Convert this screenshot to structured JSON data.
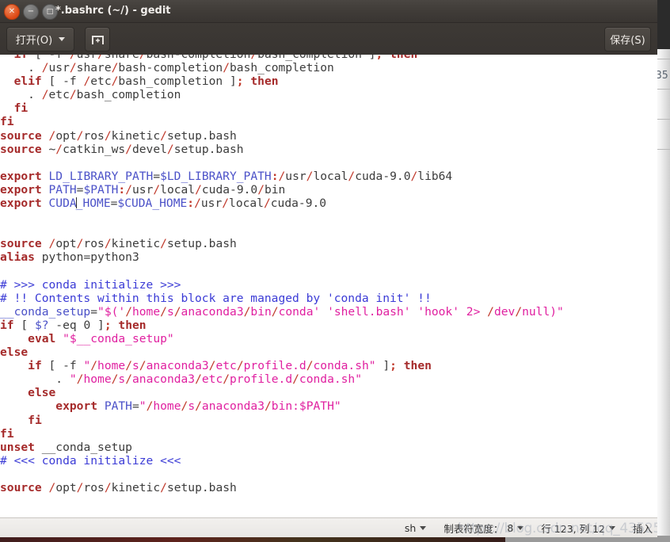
{
  "window": {
    "title": "*.bashrc (~/) - gedit",
    "controls": [
      {
        "name": "close",
        "glyph": "✕"
      },
      {
        "name": "minimize",
        "glyph": "−"
      },
      {
        "name": "maximize",
        "glyph": "□"
      }
    ]
  },
  "toolbar": {
    "open_label": "打开(O)",
    "new_tab_tooltip": "new-document",
    "save_label": "保存(S)"
  },
  "statusbar": {
    "language": "sh",
    "tab_width_label": "制表符宽度：",
    "tab_width_value": "8",
    "position": "行 123, 列 12",
    "insert_mode": "插入"
  },
  "watermark": "https://blog.csdn.net/qq_43525",
  "background_window": {
    "visible_number": "35"
  },
  "editor": {
    "lines": [
      [
        {
          "t": "tx",
          "s": "  "
        },
        {
          "t": "kw",
          "s": "if"
        },
        {
          "t": "tx",
          "s": " [ -f "
        },
        {
          "t": "pl",
          "s": "/"
        },
        {
          "t": "tx",
          "s": "usr"
        },
        {
          "t": "pl",
          "s": "/"
        },
        {
          "t": "tx",
          "s": "share"
        },
        {
          "t": "pl",
          "s": "/"
        },
        {
          "t": "tx",
          "s": "bash-completion"
        },
        {
          "t": "pl",
          "s": "/"
        },
        {
          "t": "tx",
          "s": "bash_completion ]"
        },
        {
          "t": "op",
          "s": ";"
        },
        {
          "t": "tx",
          "s": " "
        },
        {
          "t": "kw",
          "s": "then"
        }
      ],
      [
        {
          "t": "tx",
          "s": "    . "
        },
        {
          "t": "pl",
          "s": "/"
        },
        {
          "t": "tx",
          "s": "usr"
        },
        {
          "t": "pl",
          "s": "/"
        },
        {
          "t": "tx",
          "s": "share"
        },
        {
          "t": "pl",
          "s": "/"
        },
        {
          "t": "tx",
          "s": "bash-completion"
        },
        {
          "t": "pl",
          "s": "/"
        },
        {
          "t": "tx",
          "s": "bash_completion"
        }
      ],
      [
        {
          "t": "tx",
          "s": "  "
        },
        {
          "t": "kw",
          "s": "elif"
        },
        {
          "t": "tx",
          "s": " [ -f "
        },
        {
          "t": "pl",
          "s": "/"
        },
        {
          "t": "tx",
          "s": "etc"
        },
        {
          "t": "pl",
          "s": "/"
        },
        {
          "t": "tx",
          "s": "bash_completion ]"
        },
        {
          "t": "op",
          "s": ";"
        },
        {
          "t": "tx",
          "s": " "
        },
        {
          "t": "kw",
          "s": "then"
        }
      ],
      [
        {
          "t": "tx",
          "s": "    . "
        },
        {
          "t": "pl",
          "s": "/"
        },
        {
          "t": "tx",
          "s": "etc"
        },
        {
          "t": "pl",
          "s": "/"
        },
        {
          "t": "tx",
          "s": "bash_completion"
        }
      ],
      [
        {
          "t": "tx",
          "s": "  "
        },
        {
          "t": "kw",
          "s": "fi"
        }
      ],
      [
        {
          "t": "kw",
          "s": "fi"
        }
      ],
      [
        {
          "t": "kw",
          "s": "source"
        },
        {
          "t": "tx",
          "s": " "
        },
        {
          "t": "pl",
          "s": "/"
        },
        {
          "t": "tx",
          "s": "opt"
        },
        {
          "t": "pl",
          "s": "/"
        },
        {
          "t": "tx",
          "s": "ros"
        },
        {
          "t": "pl",
          "s": "/"
        },
        {
          "t": "tx",
          "s": "kinetic"
        },
        {
          "t": "pl",
          "s": "/"
        },
        {
          "t": "tx",
          "s": "setup.bash"
        }
      ],
      [
        {
          "t": "kw",
          "s": "source"
        },
        {
          "t": "tx",
          "s": " ~"
        },
        {
          "t": "pl",
          "s": "/"
        },
        {
          "t": "tx",
          "s": "catkin_ws"
        },
        {
          "t": "pl",
          "s": "/"
        },
        {
          "t": "tx",
          "s": "devel"
        },
        {
          "t": "pl",
          "s": "/"
        },
        {
          "t": "tx",
          "s": "setup.bash"
        }
      ],
      [],
      [
        {
          "t": "kw",
          "s": "export"
        },
        {
          "t": "tx",
          "s": " "
        },
        {
          "t": "var",
          "s": "LD_LIBRARY_PATH"
        },
        {
          "t": "tx",
          "s": "="
        },
        {
          "t": "var",
          "s": "$LD_LIBRARY_PATH"
        },
        {
          "t": "op",
          "s": ":"
        },
        {
          "t": "pl",
          "s": "/"
        },
        {
          "t": "tx",
          "s": "usr"
        },
        {
          "t": "pl",
          "s": "/"
        },
        {
          "t": "tx",
          "s": "local"
        },
        {
          "t": "pl",
          "s": "/"
        },
        {
          "t": "tx",
          "s": "cuda-9.0"
        },
        {
          "t": "pl",
          "s": "/"
        },
        {
          "t": "tx",
          "s": "lib64"
        }
      ],
      [
        {
          "t": "kw",
          "s": "export"
        },
        {
          "t": "tx",
          "s": " "
        },
        {
          "t": "var",
          "s": "PATH"
        },
        {
          "t": "tx",
          "s": "="
        },
        {
          "t": "var",
          "s": "$PATH"
        },
        {
          "t": "op",
          "s": ":"
        },
        {
          "t": "pl",
          "s": "/"
        },
        {
          "t": "tx",
          "s": "usr"
        },
        {
          "t": "pl",
          "s": "/"
        },
        {
          "t": "tx",
          "s": "local"
        },
        {
          "t": "pl",
          "s": "/"
        },
        {
          "t": "tx",
          "s": "cuda-9.0"
        },
        {
          "t": "pl",
          "s": "/"
        },
        {
          "t": "tx",
          "s": "bin"
        }
      ],
      [
        {
          "t": "kw",
          "s": "export"
        },
        {
          "t": "tx",
          "s": " "
        },
        {
          "t": "var",
          "s": "CUDA"
        },
        {
          "t": "caret",
          "s": ""
        },
        {
          "t": "var",
          "s": "_HOME"
        },
        {
          "t": "tx",
          "s": "="
        },
        {
          "t": "var",
          "s": "$CUDA_HOME"
        },
        {
          "t": "op",
          "s": ":"
        },
        {
          "t": "pl",
          "s": "/"
        },
        {
          "t": "tx",
          "s": "usr"
        },
        {
          "t": "pl",
          "s": "/"
        },
        {
          "t": "tx",
          "s": "local"
        },
        {
          "t": "pl",
          "s": "/"
        },
        {
          "t": "tx",
          "s": "cuda-9.0"
        }
      ],
      [],
      [],
      [
        {
          "t": "kw",
          "s": "source"
        },
        {
          "t": "tx",
          "s": " "
        },
        {
          "t": "pl",
          "s": "/"
        },
        {
          "t": "tx",
          "s": "opt"
        },
        {
          "t": "pl",
          "s": "/"
        },
        {
          "t": "tx",
          "s": "ros"
        },
        {
          "t": "pl",
          "s": "/"
        },
        {
          "t": "tx",
          "s": "kinetic"
        },
        {
          "t": "pl",
          "s": "/"
        },
        {
          "t": "tx",
          "s": "setup.bash"
        }
      ],
      [
        {
          "t": "kw",
          "s": "alias"
        },
        {
          "t": "tx",
          "s": " python=python3"
        }
      ],
      [],
      [
        {
          "t": "cm",
          "s": "# >>> conda initialize >>>"
        }
      ],
      [
        {
          "t": "cm",
          "s": "# !! Contents within this block are managed by 'conda init' !!"
        }
      ],
      [
        {
          "t": "var",
          "s": "__conda_setup"
        },
        {
          "t": "tx",
          "s": "="
        },
        {
          "t": "st",
          "s": "\"$('"
        },
        {
          "t": "pl",
          "s": "/"
        },
        {
          "t": "st",
          "s": "home"
        },
        {
          "t": "pl",
          "s": "/"
        },
        {
          "t": "st",
          "s": "s"
        },
        {
          "t": "pl",
          "s": "/"
        },
        {
          "t": "st",
          "s": "anaconda3"
        },
        {
          "t": "pl",
          "s": "/"
        },
        {
          "t": "st",
          "s": "bin"
        },
        {
          "t": "pl",
          "s": "/"
        },
        {
          "t": "st",
          "s": "conda' 'shell.bash' 'hook' 2> "
        },
        {
          "t": "pl",
          "s": "/"
        },
        {
          "t": "st",
          "s": "dev"
        },
        {
          "t": "pl",
          "s": "/"
        },
        {
          "t": "st",
          "s": "null)\""
        }
      ],
      [
        {
          "t": "kw",
          "s": "if"
        },
        {
          "t": "tx",
          "s": " [ "
        },
        {
          "t": "var",
          "s": "$?"
        },
        {
          "t": "tx",
          "s": " -eq 0 ]"
        },
        {
          "t": "op",
          "s": ";"
        },
        {
          "t": "tx",
          "s": " "
        },
        {
          "t": "kw",
          "s": "then"
        }
      ],
      [
        {
          "t": "tx",
          "s": "    "
        },
        {
          "t": "kw",
          "s": "eval"
        },
        {
          "t": "tx",
          "s": " "
        },
        {
          "t": "st",
          "s": "\"$__conda_setup\""
        }
      ],
      [
        {
          "t": "kw",
          "s": "else"
        }
      ],
      [
        {
          "t": "tx",
          "s": "    "
        },
        {
          "t": "kw",
          "s": "if"
        },
        {
          "t": "tx",
          "s": " [ -f "
        },
        {
          "t": "st",
          "s": "\""
        },
        {
          "t": "pl",
          "s": "/"
        },
        {
          "t": "st",
          "s": "home"
        },
        {
          "t": "pl",
          "s": "/"
        },
        {
          "t": "st",
          "s": "s"
        },
        {
          "t": "pl",
          "s": "/"
        },
        {
          "t": "st",
          "s": "anaconda3"
        },
        {
          "t": "pl",
          "s": "/"
        },
        {
          "t": "st",
          "s": "etc"
        },
        {
          "t": "pl",
          "s": "/"
        },
        {
          "t": "st",
          "s": "profile.d"
        },
        {
          "t": "pl",
          "s": "/"
        },
        {
          "t": "st",
          "s": "conda.sh\""
        },
        {
          "t": "tx",
          "s": " ]"
        },
        {
          "t": "op",
          "s": ";"
        },
        {
          "t": "tx",
          "s": " "
        },
        {
          "t": "kw",
          "s": "then"
        }
      ],
      [
        {
          "t": "tx",
          "s": "        . "
        },
        {
          "t": "st",
          "s": "\""
        },
        {
          "t": "pl",
          "s": "/"
        },
        {
          "t": "st",
          "s": "home"
        },
        {
          "t": "pl",
          "s": "/"
        },
        {
          "t": "st",
          "s": "s"
        },
        {
          "t": "pl",
          "s": "/"
        },
        {
          "t": "st",
          "s": "anaconda3"
        },
        {
          "t": "pl",
          "s": "/"
        },
        {
          "t": "st",
          "s": "etc"
        },
        {
          "t": "pl",
          "s": "/"
        },
        {
          "t": "st",
          "s": "profile.d"
        },
        {
          "t": "pl",
          "s": "/"
        },
        {
          "t": "st",
          "s": "conda.sh\""
        }
      ],
      [
        {
          "t": "tx",
          "s": "    "
        },
        {
          "t": "kw",
          "s": "else"
        }
      ],
      [
        {
          "t": "tx",
          "s": "        "
        },
        {
          "t": "kw",
          "s": "export"
        },
        {
          "t": "tx",
          "s": " "
        },
        {
          "t": "var",
          "s": "PATH"
        },
        {
          "t": "tx",
          "s": "="
        },
        {
          "t": "st",
          "s": "\""
        },
        {
          "t": "pl",
          "s": "/"
        },
        {
          "t": "st",
          "s": "home"
        },
        {
          "t": "pl",
          "s": "/"
        },
        {
          "t": "st",
          "s": "s"
        },
        {
          "t": "pl",
          "s": "/"
        },
        {
          "t": "st",
          "s": "anaconda3"
        },
        {
          "t": "pl",
          "s": "/"
        },
        {
          "t": "st",
          "s": "bin:$PATH\""
        }
      ],
      [
        {
          "t": "tx",
          "s": "    "
        },
        {
          "t": "kw",
          "s": "fi"
        }
      ],
      [
        {
          "t": "kw",
          "s": "fi"
        }
      ],
      [
        {
          "t": "kw",
          "s": "unset"
        },
        {
          "t": "tx",
          "s": " __conda_setup"
        }
      ],
      [
        {
          "t": "cm",
          "s": "# <<< conda initialize <<<"
        }
      ],
      [],
      [
        {
          "t": "kw",
          "s": "source"
        },
        {
          "t": "tx",
          "s": " "
        },
        {
          "t": "pl",
          "s": "/"
        },
        {
          "t": "tx",
          "s": "opt"
        },
        {
          "t": "pl",
          "s": "/"
        },
        {
          "t": "tx",
          "s": "ros"
        },
        {
          "t": "pl",
          "s": "/"
        },
        {
          "t": "tx",
          "s": "kinetic"
        },
        {
          "t": "pl",
          "s": "/"
        },
        {
          "t": "tx",
          "s": "setup.bash"
        }
      ]
    ]
  }
}
